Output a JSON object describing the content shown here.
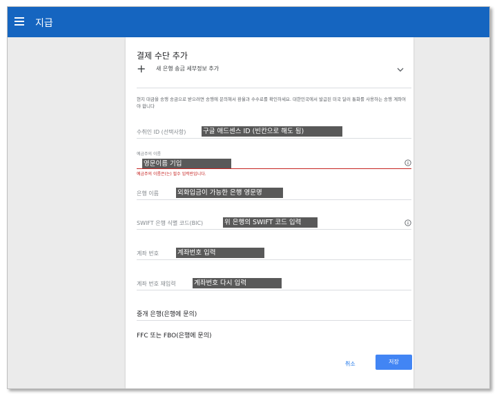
{
  "app": {
    "title": "지급"
  },
  "card": {
    "title": "결제 수단 추가",
    "add_bank_label": "새 은행 송금 세부정보 추가",
    "info_text": "현지 대금을 송행 송금으로 받으려면 송행에 문의해서 환율과 수수료를 확인하세요. 대한민국에서 발급된 미국 달러 통화를 사용하는 송행 계좌여야 합니다",
    "fields": {
      "payee_id": {
        "label": "수취인 ID (선택사항)",
        "annotation": "구글 애드센스 ID (빈칸으로 해도 됨)"
      },
      "account_holder": {
        "label": "예금주의 이름",
        "annotation": "영문이름 기입",
        "error": "예금주의 이름은(는) 필수 입력란입니다."
      },
      "bank_name": {
        "label": "은행 이름",
        "annotation": "외화입금이 가능한 은행 영문명"
      },
      "swift": {
        "label": "SWIFT 은행 식별 코드(BIC)",
        "annotation": "위 은행의 SWIFT 코드 입력"
      },
      "account_number": {
        "label": "계좌 번호",
        "annotation": "계좌번호 입력"
      },
      "account_number_confirm": {
        "label": "계좌 번호 재입력",
        "annotation": "계좌번호 다시 입력"
      },
      "intermediary_bank": {
        "label": "중개 은행(은행에 문의)"
      },
      "ffc": {
        "label": "FFC 또는 FBO(은행에 문의)"
      }
    },
    "buttons": {
      "cancel": "취소",
      "save": "저장"
    }
  },
  "icons": [
    "menu-icon",
    "plus-icon",
    "chevron-down-icon",
    "info-icon"
  ],
  "colors": {
    "topbar": "#1565c0",
    "primary": "#4285f4",
    "error": "#c5221f",
    "annotation_bg": "#595959"
  }
}
